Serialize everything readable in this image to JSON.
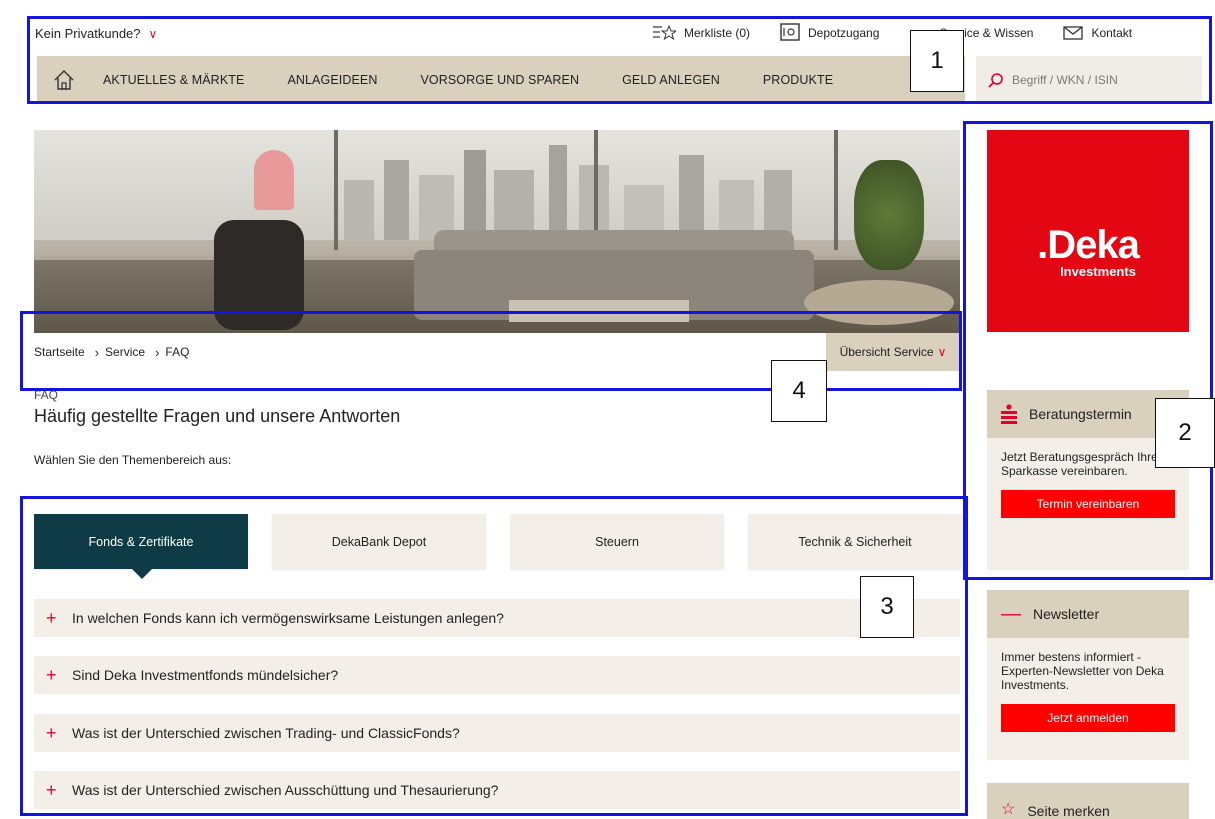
{
  "top": {
    "privat_label": "Kein Privatkunde?",
    "merkliste": "Merkliste (0)",
    "depot": "Depotzugang",
    "service": "Service & Wissen",
    "kontakt": "Kontakt"
  },
  "nav": {
    "items": [
      "AKTUELLES & MÄRKTE",
      "ANLAGEIDEEN",
      "VORSORGE UND SPAREN",
      "GELD ANLEGEN",
      "PRODUKTE"
    ],
    "search_placeholder": "Begriff / WKN / ISIN"
  },
  "breadcrumb": {
    "items": [
      "Startseite",
      "Service",
      "FAQ"
    ],
    "overview": "Übersicht Service"
  },
  "faq": {
    "label": "FAQ",
    "title": "Häufig gestellte Fragen und unsere Antworten",
    "intro": "Wählen Sie den Themenbereich aus:",
    "tabs": [
      "Fonds & Zertifikate",
      "DekaBank Depot",
      "Steuern",
      "Technik & Sicherheit"
    ],
    "active_tab": "Fonds & Zertifikate",
    "questions": [
      "In welchen Fonds kann ich vermögenswirksame Leistungen anlegen?",
      "Sind Deka Investmentfonds mündelsicher?",
      "Was ist der Unterschied zwischen Trading- und ClassicFonds?",
      "Was ist der Unterschied zwischen Ausschüttung und Thesaurierung?"
    ]
  },
  "sidebar": {
    "logo_word": ".Deka",
    "logo_sub": "Investments",
    "beratung": {
      "title": "Beratungstermin",
      "text": "Jetzt Beratungsgespräch Ihrer Sparkasse vereinbaren.",
      "button": "Termin vereinbaren"
    },
    "newsletter": {
      "title": "Newsletter",
      "text": "Immer bestens informiert - Experten-Newsletter von Deka Investments.",
      "button": "Jetzt anmelden"
    },
    "merken": {
      "title": "Seite merken"
    }
  },
  "annotations": [
    "1",
    "2",
    "3",
    "4"
  ],
  "colors": {
    "accent_red": "#e4002b",
    "nav_beige": "#d9d0bd",
    "tab_active": "#0e3b45",
    "annotation_blue": "#1414e0"
  }
}
